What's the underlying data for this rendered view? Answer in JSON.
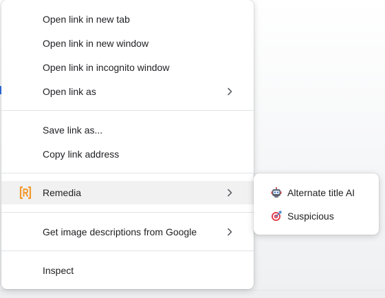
{
  "context_menu": {
    "items": [
      {
        "label": "Open link in new tab"
      },
      {
        "label": "Open link in new window"
      },
      {
        "label": "Open link in incognito window"
      },
      {
        "label": "Open link as"
      },
      {
        "label": "Save link as..."
      },
      {
        "label": "Copy link address"
      },
      {
        "label": "Remedia",
        "icon": "remedia-logo-icon"
      },
      {
        "label": "Get image descriptions from Google"
      },
      {
        "label": "Inspect"
      }
    ]
  },
  "submenu": {
    "items": [
      {
        "label": "Alternate title AI",
        "icon": "robot-icon"
      },
      {
        "label": "Suspicious",
        "icon": "target-icon"
      }
    ]
  },
  "colors": {
    "accent_orange": "#f29a2e",
    "menu_text": "#202124",
    "highlight": "#f1f1f1",
    "separator": "#e0e3e6"
  }
}
